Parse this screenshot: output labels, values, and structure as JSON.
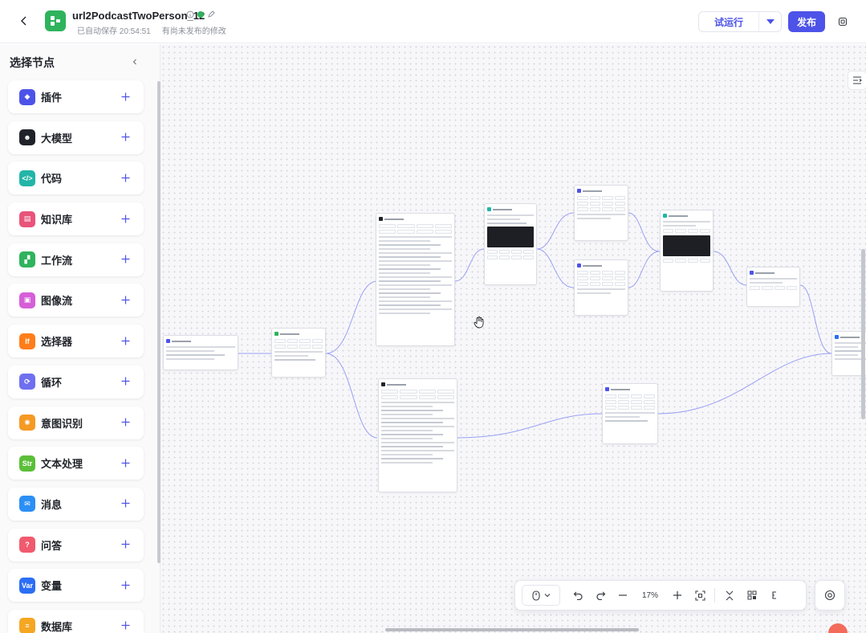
{
  "header": {
    "title": "url2PodcastTwoPerson_12",
    "autosave": "已自动保存 20:54:51",
    "unpublished": "有尚未发布的修改",
    "trial_run": "试运行",
    "publish": "发布"
  },
  "sidebar": {
    "title": "选择节点",
    "items": [
      {
        "label": "插件",
        "icon": "plugin-icon",
        "color": "#4d53e8",
        "glyph": "◆"
      },
      {
        "label": "大模型",
        "icon": "llm-icon",
        "color": "#1f2329",
        "glyph": "☻"
      },
      {
        "label": "代码",
        "icon": "code-icon",
        "color": "#22b5a8",
        "glyph": "</>"
      },
      {
        "label": "知识库",
        "icon": "knowledge-icon",
        "color": "#e8547a",
        "glyph": "▤"
      },
      {
        "label": "工作流",
        "icon": "workflow-icon",
        "color": "#2fb35d",
        "glyph": "▞"
      },
      {
        "label": "图像流",
        "icon": "imageflow-icon",
        "color": "#d65fd8",
        "glyph": "▣"
      },
      {
        "label": "选择器",
        "icon": "selector-icon",
        "color": "#ff7d1a",
        "glyph": "If"
      },
      {
        "label": "循环",
        "icon": "loop-icon",
        "color": "#6f6ff0",
        "glyph": "⟳"
      },
      {
        "label": "意图识别",
        "icon": "intent-icon",
        "color": "#f59a23",
        "glyph": "✺"
      },
      {
        "label": "文本处理",
        "icon": "text-process-icon",
        "color": "#5bbf3a",
        "glyph": "Str"
      },
      {
        "label": "消息",
        "icon": "message-icon",
        "color": "#2b8ff5",
        "glyph": "✉"
      },
      {
        "label": "问答",
        "icon": "qa-icon",
        "color": "#f05a6e",
        "glyph": "?"
      },
      {
        "label": "变量",
        "icon": "variable-icon",
        "color": "#2b6ef5",
        "glyph": "Var"
      },
      {
        "label": "数据库",
        "icon": "database-icon",
        "color": "#f5a623",
        "glyph": "≡"
      }
    ]
  },
  "toolbar": {
    "zoom": "17%"
  },
  "colors": {
    "accent": "#4d53e8",
    "edge": "#8f95f0"
  }
}
